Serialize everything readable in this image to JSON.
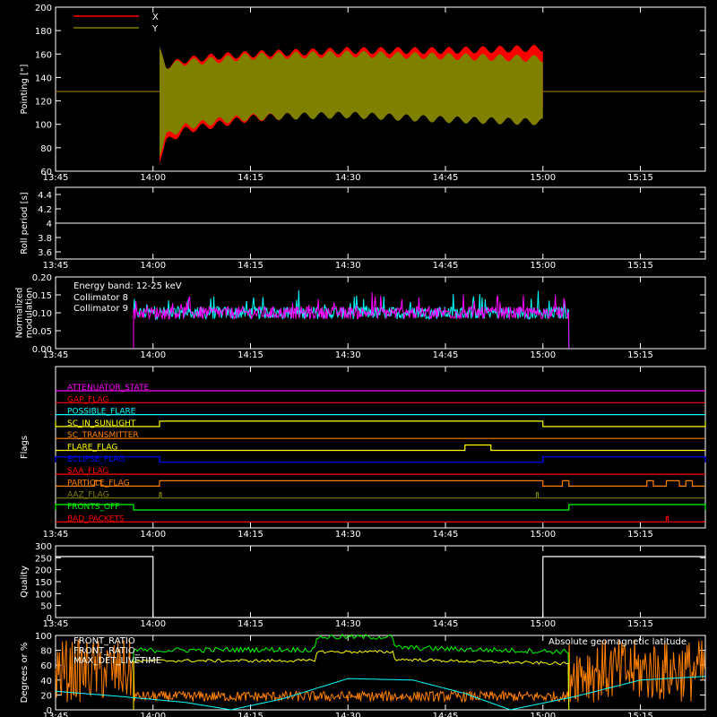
{
  "chart_data": [
    {
      "type": "area",
      "ylabel": "Pointing [\"]",
      "ylim": [
        60,
        200
      ],
      "yticks": [
        60,
        80,
        100,
        120,
        140,
        160,
        180,
        200
      ],
      "xlim": [
        "13:45",
        "15:25"
      ],
      "xticks": [
        "13:45",
        "14:00",
        "14:15",
        "14:30",
        "14:45",
        "15:00",
        "15:15"
      ],
      "legend": "top-left",
      "series": [
        {
          "name": "X",
          "color": "#ff0000",
          "baseline": 128,
          "active": [
            "14:01",
            "15:00"
          ],
          "envelope_x": [
            "14:01",
            "14:02",
            "14:05",
            "14:10",
            "14:15",
            "14:30",
            "14:45",
            "15:00"
          ],
          "upper": [
            163,
            150,
            155,
            158,
            160,
            163,
            163,
            165
          ],
          "lower": [
            70,
            85,
            95,
            100,
            105,
            110,
            110,
            110
          ]
        },
        {
          "name": "Y",
          "color": "#808000",
          "baseline": 128,
          "active": [
            "14:01",
            "15:00"
          ],
          "envelope_x": [
            "14:01",
            "14:02",
            "14:05",
            "14:10",
            "14:15",
            "14:30",
            "14:45",
            "15:00"
          ],
          "upper": [
            163,
            150,
            153,
            155,
            158,
            160,
            158,
            156
          ],
          "lower": [
            75,
            90,
            98,
            103,
            106,
            108,
            104,
            102
          ]
        }
      ]
    },
    {
      "type": "line",
      "ylabel": "Roll period [s]",
      "ylim": [
        3.5,
        4.5
      ],
      "yticks": [
        3.6,
        3.8,
        4.0,
        4.2,
        4.4
      ],
      "series": [
        {
          "color": "#ffffff",
          "x": [
            "13:45",
            "15:25"
          ],
          "y": [
            4.0,
            4.0
          ]
        }
      ]
    },
    {
      "type": "line",
      "ylabel": "Normalized modulation",
      "ylim": [
        0,
        0.2
      ],
      "yticks": [
        "0.00",
        "0.05",
        "0.10",
        "0.15",
        "0.20"
      ],
      "annotation": "Energy band: 12-25 keV",
      "active": [
        "13:57",
        "15:04"
      ],
      "series": [
        {
          "name": "Collimator 8",
          "color": "#00ffff",
          "mean": 0.1
        },
        {
          "name": "Collimator 9",
          "color": "#ff00ff",
          "mean": 0.1
        }
      ]
    },
    {
      "type": "line",
      "ylabel": "Flags",
      "flags": [
        {
          "name": "ATTENUATOR_STATE",
          "color": "#ff00ff",
          "high": []
        },
        {
          "name": "GAP_FLAG",
          "color": "#ff0000",
          "high": []
        },
        {
          "name": "POSSIBLE_FLARE",
          "color": "#00ffff",
          "high": []
        },
        {
          "name": "SC_IN_SUNLIGHT",
          "color": "#ffff00",
          "high": [
            [
              "13:45",
              "14:01"
            ],
            [
              "15:00",
              "15:25"
            ]
          ],
          "inverted": true
        },
        {
          "name": "SC_TRANSMITTER",
          "color": "#ff8000",
          "high": []
        },
        {
          "name": "FLARE_FLAG",
          "color": "#ffff00",
          "high": [
            [
              "14:48",
              "14:52"
            ]
          ]
        },
        {
          "name": "ECLIPSE_FLAG",
          "color": "#0000ff",
          "high": [
            [
              "13:45",
              "14:01"
            ],
            [
              "15:00",
              "15:25"
            ]
          ]
        },
        {
          "name": "SAA_FLAG",
          "color": "#ff0000",
          "high": []
        },
        {
          "name": "PARTICLE_FLAG",
          "color": "#ff8000",
          "high": [
            [
              "13:51",
              "13:52"
            ],
            [
              "14:01",
              "15:00"
            ],
            [
              "15:03",
              "15:04"
            ],
            [
              "15:16",
              "15:17"
            ],
            [
              "15:19",
              "15:21"
            ],
            [
              "15:22",
              "15:23"
            ]
          ]
        },
        {
          "name": "AAZ_FLAG",
          "color": "#808000",
          "high": [
            [
              "14:01",
              "14:01"
            ],
            [
              "14:59",
              "14:59"
            ]
          ]
        },
        {
          "name": "FRONTS_OFF",
          "color": "#00ff00",
          "high": [
            [
              "13:45",
              "13:57"
            ],
            [
              "15:04",
              "15:25"
            ]
          ]
        },
        {
          "name": "BAD_PACKETS",
          "color": "#ff0000",
          "high": [
            [
              "15:19",
              "15:19"
            ]
          ]
        }
      ]
    },
    {
      "type": "line",
      "ylabel": "Quality",
      "ylim": [
        0,
        300
      ],
      "yticks": [
        0,
        50,
        100,
        150,
        200,
        250,
        300
      ],
      "series": [
        {
          "color": "#ffffff",
          "x": [
            "13:45",
            "14:00",
            "14:00",
            "15:00",
            "15:00",
            "15:25"
          ],
          "y": [
            255,
            255,
            0,
            0,
            255,
            255
          ]
        }
      ]
    },
    {
      "type": "line",
      "ylabel": "Degrees or %",
      "ylim": [
        0,
        100
      ],
      "yticks": [
        0,
        20,
        40,
        60,
        80,
        100
      ],
      "series": [
        {
          "name": "FRONT_RATIO",
          "color": "#00ff00",
          "x": [
            "13:57",
            "14:00",
            "14:15",
            "14:25",
            "14:25",
            "14:37",
            "14:37",
            "14:45",
            "15:04"
          ],
          "y": [
            80,
            80,
            81,
            81,
            98,
            98,
            84,
            82,
            78
          ]
        },
        {
          "name": "FRONT_RATIO_",
          "color": "#ffff00",
          "x": [
            "13:57",
            "14:00",
            "14:15",
            "14:25",
            "14:25",
            "14:37",
            "14:37",
            "14:45",
            "15:04"
          ],
          "y": [
            65,
            66,
            66,
            66,
            78,
            78,
            68,
            66,
            62
          ]
        },
        {
          "name": "MAX_DET_LIVETIME",
          "color": "#ff8000",
          "mean": 18
        },
        {
          "name": "Absolute geomagnetic latitude",
          "color": "#00ffff",
          "x": [
            "13:45",
            "13:55",
            "14:05",
            "14:12",
            "14:20",
            "14:30",
            "14:40",
            "14:48",
            "14:55",
            "15:05",
            "15:15",
            "15:25"
          ],
          "y": [
            25,
            18,
            10,
            0,
            15,
            42,
            40,
            22,
            0,
            18,
            40,
            45
          ]
        }
      ]
    }
  ]
}
